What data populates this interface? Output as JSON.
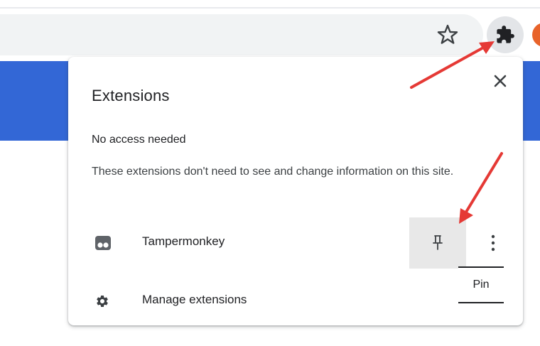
{
  "popup": {
    "title": "Extensions",
    "section_heading": "No access needed",
    "section_description": "These extensions don't need to see and change information on this site.",
    "extensions": [
      {
        "name": "Tampermonkey",
        "icon": "tampermonkey-icon",
        "pinned": false
      }
    ],
    "pin_tooltip": "Pin",
    "manage_label": "Manage extensions"
  },
  "icons": {
    "bookmark": "star-icon",
    "extensions": "puzzle-icon",
    "close": "close-icon",
    "pin": "pin-icon",
    "more": "more-vert-icon",
    "manage": "gear-icon"
  },
  "colors": {
    "toolbar_bg": "#f1f3f4",
    "page_band": "#3367d6",
    "annotation_arrow": "#e53935",
    "profile_avatar": "#e8632a",
    "pin_hover": "#e8e8e8"
  }
}
